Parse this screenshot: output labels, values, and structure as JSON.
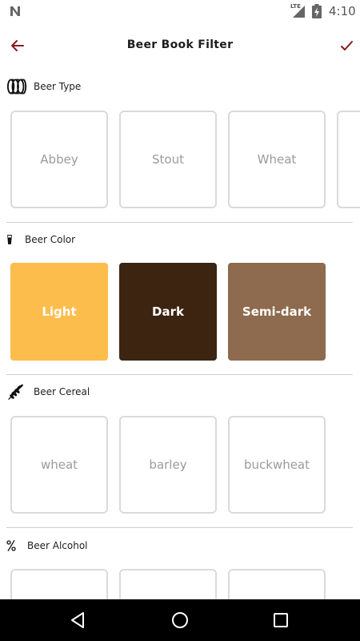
{
  "status_bar": {
    "time": "4:10",
    "network": "LTE",
    "icons": [
      "n-notification-icon",
      "signal-icon",
      "battery-icon"
    ]
  },
  "toolbar": {
    "title": "Beer Book Filter",
    "back_icon": "arrow-left-icon",
    "confirm_icon": "check-icon",
    "accent_color": "#8b1a1a"
  },
  "sections": {
    "beer_type": {
      "label": "Beer Type",
      "icon": "barrels-icon",
      "options": [
        "Abbey",
        "Stout",
        "Wheat"
      ]
    },
    "beer_color": {
      "label": "Beer Color",
      "icon": "pint-glass-icon",
      "options": [
        {
          "label": "Light",
          "color": "#fdbd4c"
        },
        {
          "label": "Dark",
          "color": "#3d2410"
        },
        {
          "label": "Semi-dark",
          "color": "#8e6a4e"
        }
      ]
    },
    "beer_cereal": {
      "label": "Beer Cereal",
      "icon": "wheat-ear-icon",
      "options": [
        "wheat",
        "barley",
        "buckwheat"
      ]
    },
    "beer_alcohol": {
      "label": "Beer Alcohol",
      "icon": "percent-icon",
      "options": [
        "",
        "",
        ""
      ]
    }
  },
  "navbar": {
    "icons": [
      "back-triangle-icon",
      "home-circle-icon",
      "recents-square-icon"
    ]
  }
}
